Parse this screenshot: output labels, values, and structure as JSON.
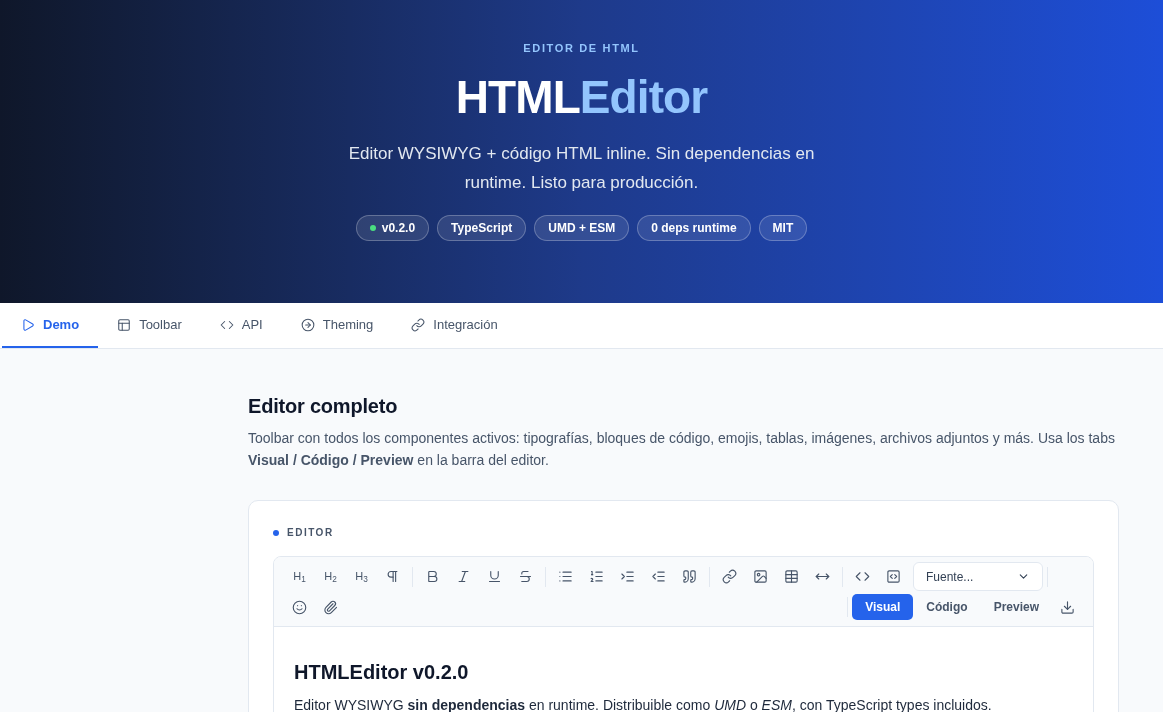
{
  "hero": {
    "eyebrow": "EDITOR DE HTML",
    "title_main": "HTML",
    "title_accent": "Editor",
    "subtitle": "Editor WYSIWYG + código HTML inline. Sin dependencias en runtime. Listo para producción.",
    "badges": [
      {
        "label": "v0.2.0",
        "color": "#4ade80"
      },
      {
        "label": "TypeScript"
      },
      {
        "label": "UMD + ESM"
      },
      {
        "label": "0 deps runtime"
      },
      {
        "label": "MIT"
      }
    ]
  },
  "tabs": [
    {
      "label": "Demo",
      "selected": true
    },
    {
      "label": "Toolbar",
      "selected": false
    },
    {
      "label": "API",
      "selected": false
    },
    {
      "label": "Theming",
      "selected": false
    },
    {
      "label": "Integración",
      "selected": false
    }
  ],
  "section": {
    "title": "Editor completo",
    "description": "Toolbar con todos los componentes activos: tipografías, bloques de código, emojis, tablas, imágenes, archivos adjuntos y más. Usa los tabs **Visual / Código / Preview** en la barra del editor."
  },
  "editor": {
    "label": "EDITOR",
    "headings": [
      "H$_{1}$",
      "H$_{2}$",
      "H$_{3}$"
    ],
    "font_select": {
      "placeholder": "Fuente..."
    },
    "modes": [
      {
        "label": "Visual",
        "selected": true
      },
      {
        "label": "Código",
        "selected": false
      },
      {
        "label": "Preview",
        "selected": false
      }
    ],
    "content_title": "HTMLEditor v0.2.0",
    "content_text": "Editor WYSIWYG **sin dependencias** en runtime. Distribuible como *UMD* o *ESM*, con TypeScript types incluidos."
  }
}
